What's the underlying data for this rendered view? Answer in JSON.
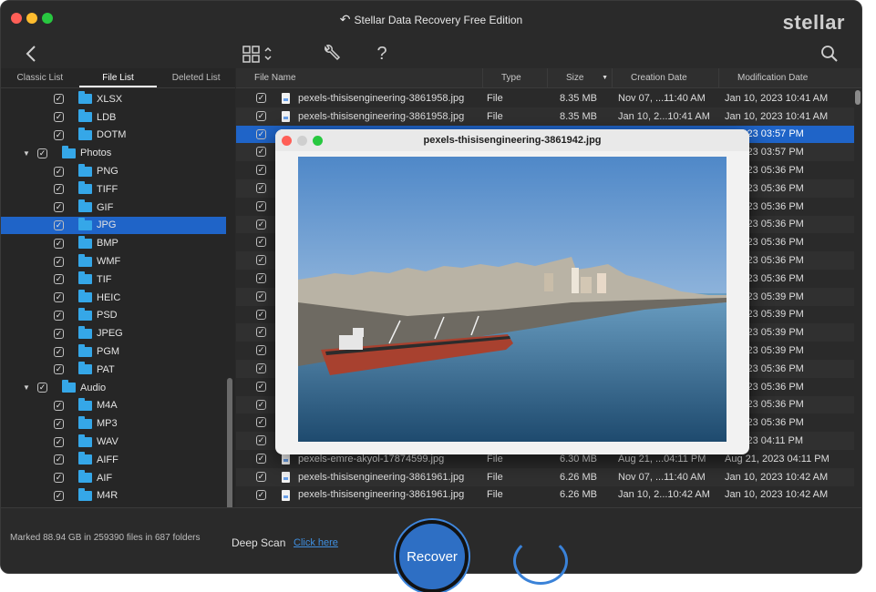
{
  "window": {
    "title": "Stellar Data Recovery Free Edition",
    "brand": "stellar"
  },
  "toolbar": {
    "back_icon": "chevron-left-icon",
    "view_icon": "grid-view-icon",
    "tools_icon": "wrench-icon",
    "help_label": "?",
    "search_icon": "search-icon"
  },
  "tabs": [
    "Classic List",
    "File List",
    "Deleted List"
  ],
  "tree": [
    {
      "label": "XLSX",
      "level": 2,
      "checked": true
    },
    {
      "label": "LDB",
      "level": 2,
      "checked": true
    },
    {
      "label": "DOTM",
      "level": 2,
      "checked": true
    },
    {
      "label": "Photos",
      "level": 1,
      "checked": true,
      "expanded": true
    },
    {
      "label": "PNG",
      "level": 2,
      "checked": true
    },
    {
      "label": "TIFF",
      "level": 2,
      "checked": true
    },
    {
      "label": "GIF",
      "level": 2,
      "checked": true
    },
    {
      "label": "JPG",
      "level": 2,
      "checked": true,
      "selected": true
    },
    {
      "label": "BMP",
      "level": 2,
      "checked": true
    },
    {
      "label": "WMF",
      "level": 2,
      "checked": true
    },
    {
      "label": "TIF",
      "level": 2,
      "checked": true
    },
    {
      "label": "HEIC",
      "level": 2,
      "checked": true
    },
    {
      "label": "PSD",
      "level": 2,
      "checked": true
    },
    {
      "label": "JPEG",
      "level": 2,
      "checked": true
    },
    {
      "label": "PGM",
      "level": 2,
      "checked": true
    },
    {
      "label": "PAT",
      "level": 2,
      "checked": true
    },
    {
      "label": "Audio",
      "level": 1,
      "checked": true,
      "expanded": true
    },
    {
      "label": "M4A",
      "level": 2,
      "checked": true
    },
    {
      "label": "MP3",
      "level": 2,
      "checked": true
    },
    {
      "label": "WAV",
      "level": 2,
      "checked": true
    },
    {
      "label": "AIFF",
      "level": 2,
      "checked": true
    },
    {
      "label": "AIF",
      "level": 2,
      "checked": true
    },
    {
      "label": "M4R",
      "level": 2,
      "checked": true
    }
  ],
  "columns": [
    "File Name",
    "Type",
    "Size",
    "Creation Date",
    "Modification Date"
  ],
  "files": [
    {
      "name": "pexels-thisisengineering-3861958.jpg",
      "type": "File",
      "size": "8.35 MB",
      "created": "Nov 07, ...11:40 AM",
      "modified": "Jan 10, 2023 10:41 AM"
    },
    {
      "name": "pexels-thisisengineering-3861958.jpg",
      "type": "File",
      "size": "8.35 MB",
      "created": "Jan 10, 2...10:41 AM",
      "modified": "Jan 10, 2023 10:41 AM"
    },
    {
      "name": "",
      "type": "",
      "size": "",
      "created": "",
      "modified": "0, 2023 03:57 PM",
      "selected": true
    },
    {
      "name": "",
      "type": "",
      "size": "",
      "created": "",
      "modified": "0, 2023 03:57 PM"
    },
    {
      "name": "",
      "type": "",
      "size": "",
      "created": "",
      "modified": "0, 2023 05:36 PM"
    },
    {
      "name": "",
      "type": "",
      "size": "",
      "created": "",
      "modified": "0, 2023 05:36 PM"
    },
    {
      "name": "",
      "type": "",
      "size": "",
      "created": "",
      "modified": "0, 2023 05:36 PM"
    },
    {
      "name": "",
      "type": "",
      "size": "",
      "created": "",
      "modified": "0, 2023 05:36 PM"
    },
    {
      "name": "",
      "type": "",
      "size": "",
      "created": "",
      "modified": "0, 2023 05:36 PM"
    },
    {
      "name": "",
      "type": "",
      "size": "",
      "created": "",
      "modified": "0, 2023 05:36 PM"
    },
    {
      "name": "",
      "type": "",
      "size": "",
      "created": "",
      "modified": "0, 2023 05:36 PM"
    },
    {
      "name": "",
      "type": "",
      "size": "",
      "created": "",
      "modified": "0, 2023 05:39 PM"
    },
    {
      "name": "",
      "type": "",
      "size": "",
      "created": "",
      "modified": "0, 2023 05:39 PM"
    },
    {
      "name": "",
      "type": "",
      "size": "",
      "created": "",
      "modified": "0, 2023 05:39 PM"
    },
    {
      "name": "",
      "type": "",
      "size": "",
      "created": "",
      "modified": "0, 2023 05:39 PM"
    },
    {
      "name": "",
      "type": "",
      "size": "",
      "created": "",
      "modified": "0, 2023 05:36 PM"
    },
    {
      "name": "",
      "type": "",
      "size": "",
      "created": "",
      "modified": "0, 2023 05:36 PM"
    },
    {
      "name": "",
      "type": "",
      "size": "",
      "created": "",
      "modified": "0, 2023 05:36 PM"
    },
    {
      "name": "",
      "type": "",
      "size": "",
      "created": "",
      "modified": "0, 2023 05:36 PM"
    },
    {
      "name": "",
      "type": "",
      "size": "",
      "created": "",
      "modified": "1, 2023 04:11 PM"
    },
    {
      "name": "pexels-emre-akyol-17874599.jpg",
      "type": "File",
      "size": "6.30 MB",
      "created": "Aug 21, ...04:11 PM",
      "modified": "Aug 21, 2023 04:11 PM"
    },
    {
      "name": "pexels-thisisengineering-3861961.jpg",
      "type": "File",
      "size": "6.26 MB",
      "created": "Nov 07, ...11:40 AM",
      "modified": "Jan 10, 2023 10:42 AM"
    },
    {
      "name": "pexels-thisisengineering-3861961.jpg",
      "type": "File",
      "size": "6.26 MB",
      "created": "Jan 10, 2...10:42 AM",
      "modified": "Jan 10, 2023 10:42 AM"
    }
  ],
  "footer": {
    "marked_text": "Marked 88.94 GB in 259390 files in 687 folders",
    "deep_scan_label": "Deep Scan",
    "deep_scan_link": "Click here",
    "recover_label": "Recover"
  },
  "preview": {
    "title": "pexels-thisisengineering-3861942.jpg",
    "image_description_icon": "harbor-photo"
  },
  "colors": {
    "selection": "#1f64c8",
    "folder": "#35a7e8",
    "recover_button": "#2e6fc4"
  }
}
